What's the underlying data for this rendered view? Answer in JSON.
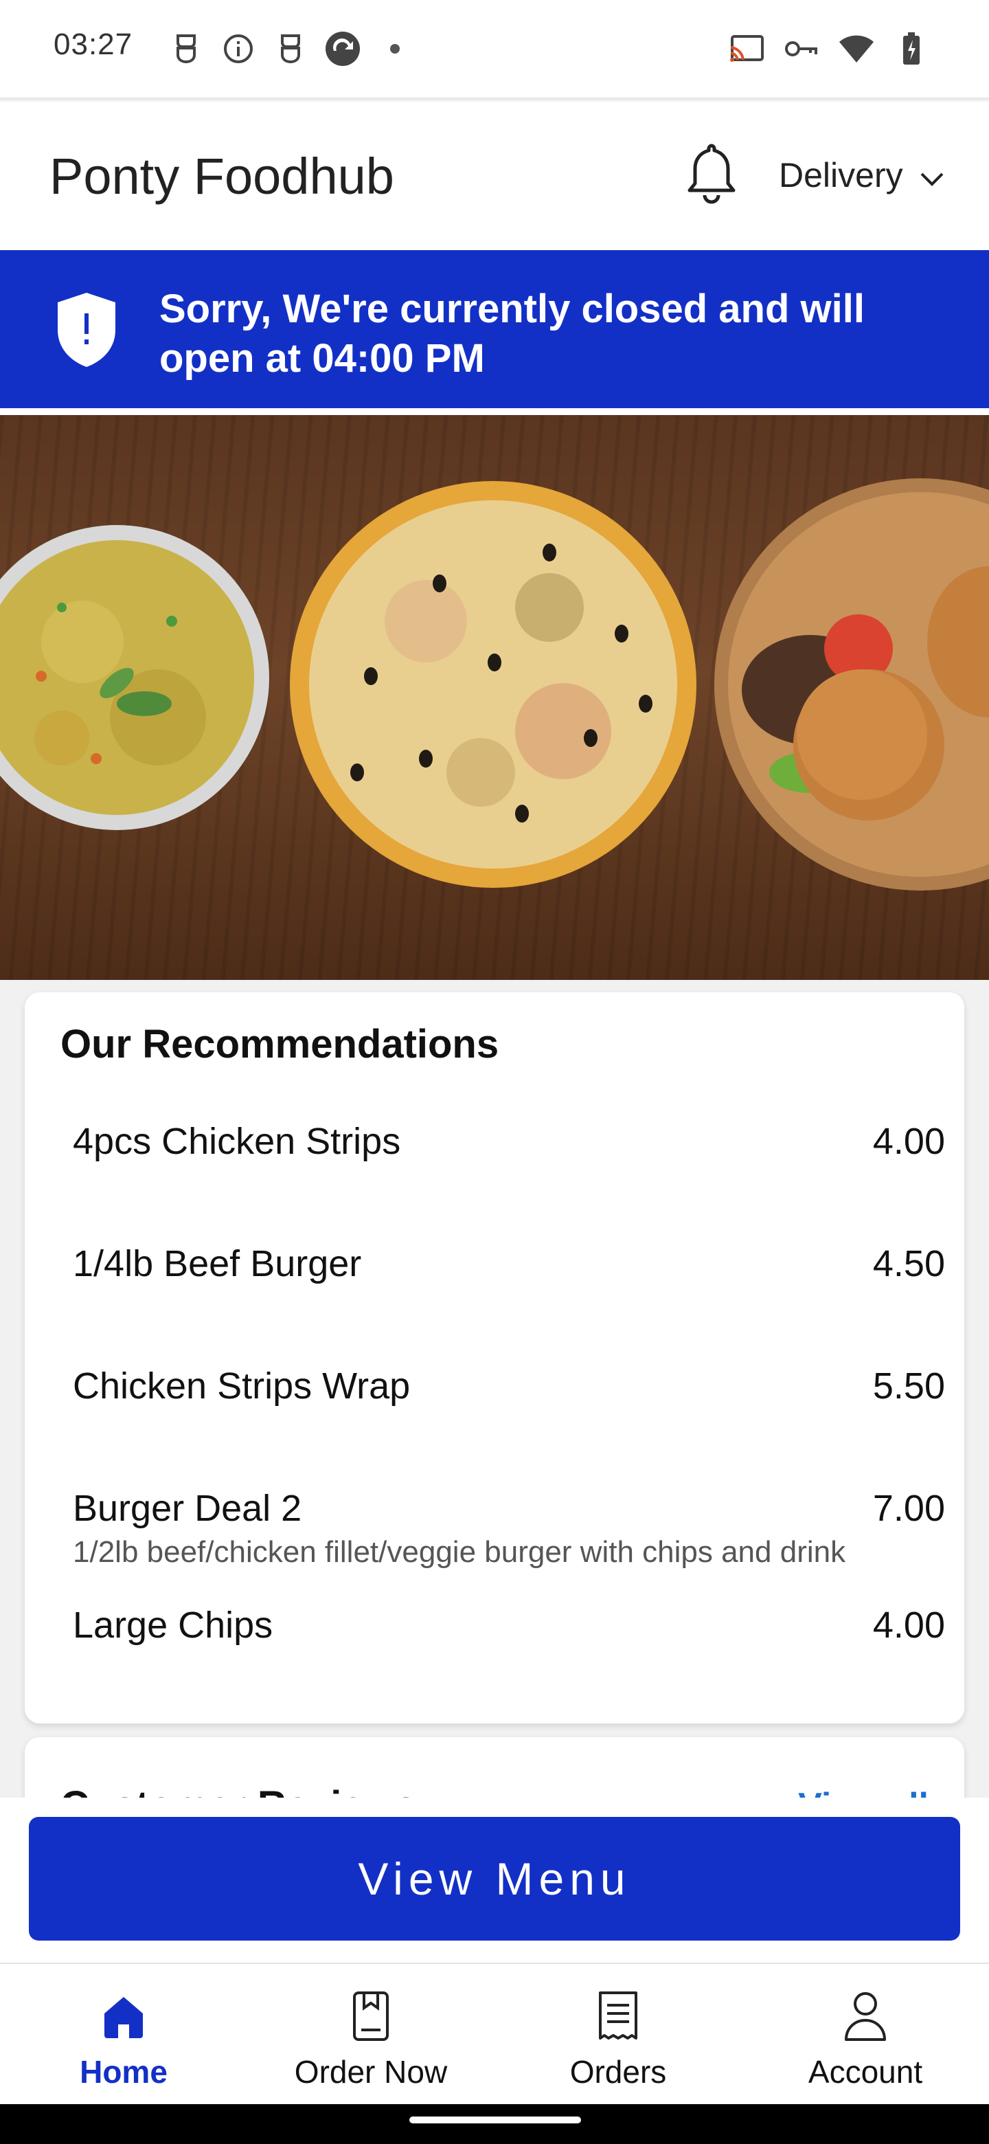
{
  "status_bar": {
    "time": "03:27",
    "left_icons": [
      "privacy-mask-icon",
      "info-icon",
      "privacy-mask-icon",
      "sync-icon",
      "dot-icon"
    ],
    "right_icons": [
      "cast-icon",
      "key-icon",
      "wifi-icon",
      "battery-charging-icon"
    ]
  },
  "header": {
    "title": "Ponty Foodhub",
    "delivery_label": "Delivery"
  },
  "banner": {
    "message": "Sorry, We're currently closed and will open at 04:00 PM",
    "color": "#1330c6"
  },
  "recommendations": {
    "title": "Our Recommendations",
    "items": [
      {
        "name": "4pcs Chicken Strips",
        "price": "4.00",
        "description": ""
      },
      {
        "name": "1/4lb Beef Burger",
        "price": "4.50",
        "description": ""
      },
      {
        "name": "Chicken Strips Wrap",
        "price": "5.50",
        "description": ""
      },
      {
        "name": "Burger Deal 2",
        "price": "7.00",
        "description": "1/2lb beef/chicken fillet/veggie burger with chips and drink"
      },
      {
        "name": "Large Chips",
        "price": "4.00",
        "description": ""
      }
    ]
  },
  "reviews": {
    "title": "Customer Reviews",
    "link": "View all"
  },
  "view_menu_label": "View Menu",
  "bottom_nav": {
    "items": [
      {
        "label": "Home",
        "icon": "home-icon",
        "active": true
      },
      {
        "label": "Order Now",
        "icon": "order-icon",
        "active": false
      },
      {
        "label": "Orders",
        "icon": "receipt-icon",
        "active": false
      },
      {
        "label": "Account",
        "icon": "person-icon",
        "active": false
      }
    ]
  },
  "accent_color": "#1330c6"
}
